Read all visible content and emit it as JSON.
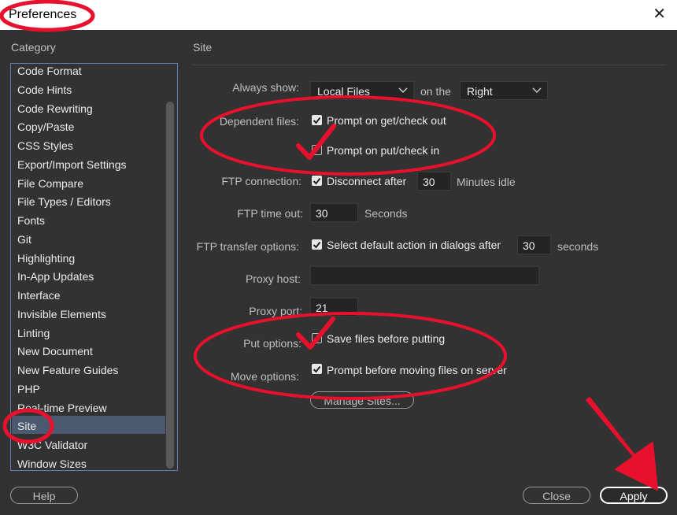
{
  "window": {
    "title": "Preferences",
    "close_symbol": "✕"
  },
  "category": {
    "label": "Category",
    "items": [
      "Code Format",
      "Code Hints",
      "Code Rewriting",
      "Copy/Paste",
      "CSS Styles",
      "Export/Import Settings",
      "File Compare",
      "File Types / Editors",
      "Fonts",
      "Git",
      "Highlighting",
      "In-App Updates",
      "Interface",
      "Invisible Elements",
      "Linting",
      "New Document",
      "New Feature Guides",
      "PHP",
      "Real-time Preview",
      "Site",
      "W3C Validator",
      "Window Sizes"
    ],
    "selected": "Site"
  },
  "panel": {
    "title": "Site",
    "always_show": {
      "label": "Always show:",
      "value": "Local Files",
      "on_the": "on the",
      "side": "Right"
    },
    "dependent_files": {
      "label": "Dependent files:",
      "get": "Prompt on get/check out",
      "put": "Prompt on put/check in",
      "get_checked": true,
      "put_checked": false
    },
    "ftp_connection": {
      "label": "FTP connection:",
      "check_label": "Disconnect after",
      "checked": true,
      "value": "30",
      "unit": "Minutes idle"
    },
    "ftp_timeout": {
      "label": "FTP time out:",
      "value": "30",
      "unit": "Seconds"
    },
    "ftp_transfer": {
      "label": "FTP transfer options:",
      "check_label": "Select default action in dialogs after",
      "checked": true,
      "value": "30",
      "unit": "seconds"
    },
    "proxy_host": {
      "label": "Proxy host:",
      "value": ""
    },
    "proxy_port": {
      "label": "Proxy port:",
      "value": "21"
    },
    "put_options": {
      "label": "Put options:",
      "check_label": "Save files before putting",
      "checked": false
    },
    "move_options": {
      "label": "Move options:",
      "check_label": "Prompt before moving files on server",
      "checked": true
    },
    "manage_sites": "Manage Sites..."
  },
  "buttons": {
    "help": "Help",
    "close": "Close",
    "apply": "Apply"
  },
  "annotation_color": "#e8112d"
}
